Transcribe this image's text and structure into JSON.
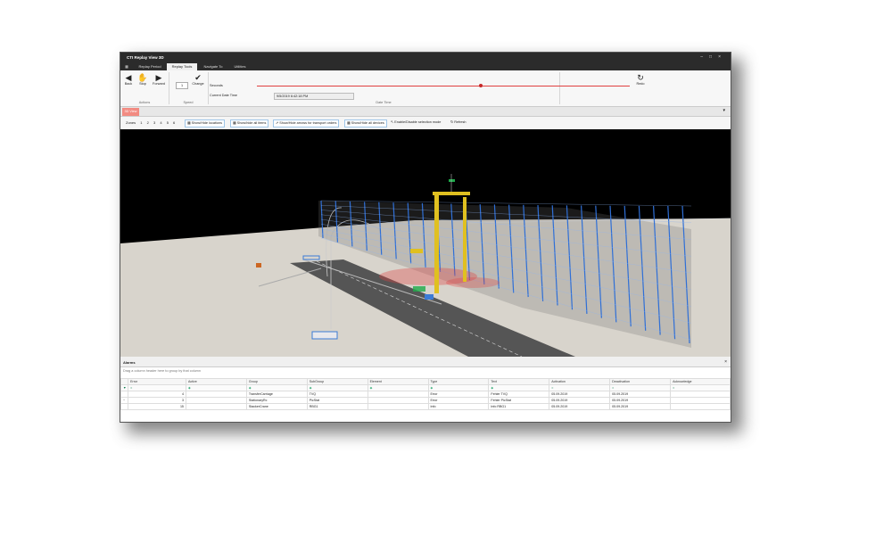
{
  "app": {
    "title": "CTI Replay View 3D",
    "logo": "CTI"
  },
  "tabs": [
    {
      "label": "Replay Period",
      "active": false
    },
    {
      "label": "Replay Tools",
      "active": true
    },
    {
      "label": "Navigate To",
      "active": false
    },
    {
      "label": "Utilities",
      "active": false
    }
  ],
  "ribbon": {
    "actions": {
      "title": "Actions",
      "back": "Back",
      "stop": "Stop",
      "forward": "Forward"
    },
    "speed": {
      "title": "Speed",
      "value": "1",
      "change": "Change"
    },
    "datetime": {
      "title": "Date Time",
      "seconds_label": "Seconds",
      "current_label": "Current Date Time",
      "current_value": "9/5/2019 6:42:18 PM",
      "redo": "Redo",
      "slider_position": 0.6
    }
  },
  "doc_tab": {
    "label": "3D View"
  },
  "toolbar": {
    "zones_label": "Zones",
    "zones": [
      "1",
      "2",
      "3",
      "4",
      "5",
      "6"
    ],
    "show_locations": "Show/Hide locations",
    "show_items": "Show/hide all items",
    "show_arrows": "Show/Hide arrows for transport orders",
    "show_devices": "Show/Hide all devices",
    "selection_mode": "Enable/Disable selection mode",
    "refresh": "Refresh"
  },
  "alarms": {
    "title": "Alarms",
    "group_hint": "Drag a column header here to group by that column",
    "columns": [
      "Error",
      "Active",
      "Group",
      "SubGroup",
      "Element",
      "Type",
      "Text",
      "Activation",
      "Deactivation",
      "Acknowledge"
    ],
    "rows": [
      {
        "error": "4",
        "active": "",
        "group": "TransferCarriage",
        "subgroup": "TVQ",
        "element": "",
        "type": "Error",
        "text": "Fehler TVQ",
        "activation": "05.09.2019",
        "deactivation": "05.09.2019",
        "ack": ""
      },
      {
        "error": "3",
        "active": "",
        "group": "StationaryRc",
        "subgroup": "PicStat",
        "element": "",
        "type": "Error",
        "text": "Fehler PicStat",
        "activation": "05.09.2019",
        "deactivation": "05.09.2019",
        "ack": ""
      },
      {
        "error": "15",
        "active": "",
        "group": "StackerCrane",
        "subgroup": "RBG1",
        "element": "",
        "type": "Info",
        "text": "Info RBG1",
        "activation": "05.09.2019",
        "deactivation": "05.09.2019",
        "ack": ""
      }
    ]
  },
  "colors": {
    "accent": "#d32f2f",
    "rack": "#2f6fd6",
    "crane": "#e0c020",
    "doc_tab": "#f28b82"
  }
}
